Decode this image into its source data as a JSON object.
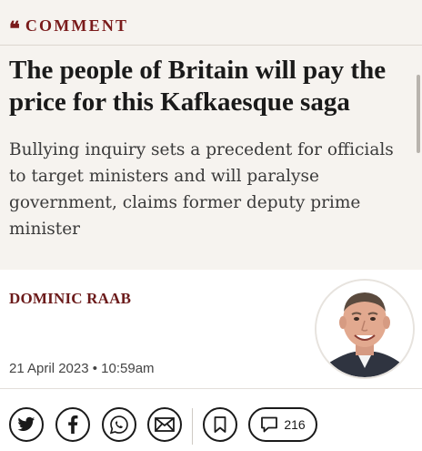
{
  "section": {
    "kicker_quote": "❝",
    "label": "COMMENT"
  },
  "article": {
    "headline": "The people of Britain will pay the price for this Kafkaesque saga",
    "standfirst": "Bullying inquiry sets a precedent for officials to target ministers and will paralyse government, claims former deputy prime minister",
    "author": "DOMINIC RAAB",
    "timestamp": "21 April 2023 • 10:59am"
  },
  "share": {
    "icons": [
      "twitter-icon",
      "facebook-icon",
      "whatsapp-icon",
      "email-icon",
      "bookmark-icon",
      "comment-icon"
    ],
    "comment_count": "216"
  },
  "colors": {
    "accent": "#7a1b1b",
    "header_bg": "#f6f3ef",
    "text": "#1a1a1a"
  }
}
